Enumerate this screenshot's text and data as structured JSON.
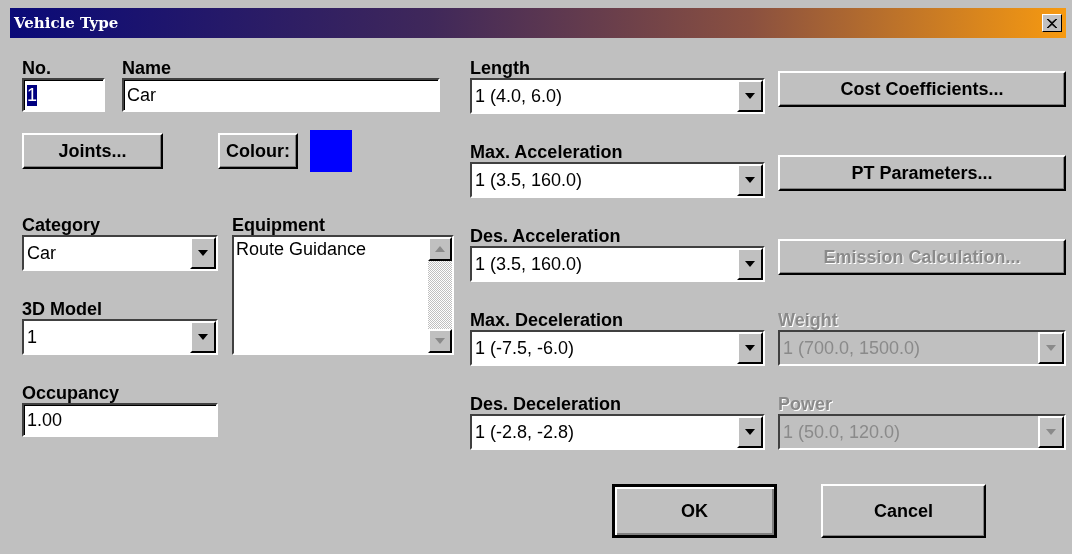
{
  "window": {
    "title": "Vehicle Type"
  },
  "number": {
    "label": "No.",
    "value": "1",
    "text_selected": true
  },
  "name": {
    "label": "Name",
    "value": "Car"
  },
  "joints_button": {
    "label": "Joints..."
  },
  "colour": {
    "label": "Colour:",
    "color": "#0000ff"
  },
  "category": {
    "label": "Category",
    "value": "Car"
  },
  "model_3d": {
    "label": "3D Model",
    "value": "1"
  },
  "occupancy": {
    "label": "Occupancy",
    "value": "1.00"
  },
  "equipment": {
    "label": "Equipment",
    "items": [
      {
        "label": "Route Guidance",
        "selected": false
      }
    ]
  },
  "middle": [
    {
      "label": "Length",
      "value": "1 (4.0, 6.0)"
    },
    {
      "label": "Max. Acceleration",
      "value": "1 (3.5, 160.0)"
    },
    {
      "label": "Des. Acceleration",
      "value": "1 (3.5, 160.0)"
    },
    {
      "label": "Max. Deceleration",
      "value": "1 (-7.5, -6.0)"
    },
    {
      "label": "Des. Deceleration",
      "value": "1 (-2.8, -2.8)"
    }
  ],
  "right": [
    {
      "kind": "button",
      "label": "Cost Coefficients...",
      "disabled": false
    },
    {
      "kind": "button",
      "label": "PT Parameters...",
      "disabled": false
    },
    {
      "kind": "button",
      "label": "Emission Calculation...",
      "disabled": true
    },
    {
      "kind": "dropdown",
      "label": "Weight",
      "value": "1 (700.0, 1500.0)",
      "disabled": true
    },
    {
      "kind": "dropdown",
      "label": "Power",
      "value": "1 (50.0, 120.0)",
      "disabled": true
    }
  ],
  "buttons": [
    {
      "label": "OK",
      "default": true
    },
    {
      "label": "Cancel",
      "default": false
    }
  ]
}
